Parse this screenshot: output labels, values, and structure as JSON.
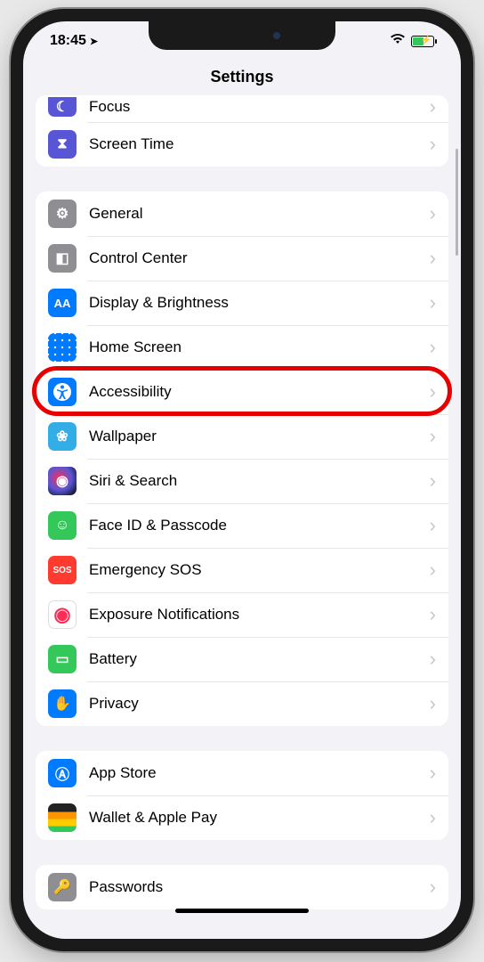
{
  "statusbar": {
    "time": "18:45",
    "location_arrow": "➤"
  },
  "navbar": {
    "title": "Settings"
  },
  "groups": [
    {
      "rows": [
        {
          "label": "Focus",
          "icon": "moon-icon",
          "bg": "bg-purple",
          "glyph": "☾",
          "truncated": true
        },
        {
          "label": "Screen Time",
          "icon": "hourglass-icon",
          "bg": "bg-purple",
          "glyph": "⧗"
        }
      ]
    },
    {
      "rows": [
        {
          "label": "General",
          "icon": "gear-icon",
          "bg": "bg-gray",
          "glyph": "⚙"
        },
        {
          "label": "Control Center",
          "icon": "switches-icon",
          "bg": "bg-gray",
          "glyph": "◧"
        },
        {
          "label": "Display & Brightness",
          "icon": "text-size-icon",
          "bg": "bg-blue",
          "glyph": "AA"
        },
        {
          "label": "Home Screen",
          "icon": "grid-icon",
          "bg": "bg-blue",
          "glyph": "",
          "grid": true
        },
        {
          "label": "Accessibility",
          "icon": "accessibility-icon",
          "bg": "bg-blue",
          "glyph": "⊕",
          "highlighted": true
        },
        {
          "label": "Wallpaper",
          "icon": "flower-icon",
          "bg": "bg-teal",
          "glyph": "❀"
        },
        {
          "label": "Siri & Search",
          "icon": "siri-icon",
          "bg": "bg-black",
          "glyph": "◉"
        },
        {
          "label": "Face ID & Passcode",
          "icon": "face-id-icon",
          "bg": "bg-green",
          "glyph": "☺"
        },
        {
          "label": "Emergency SOS",
          "icon": "sos-icon",
          "bg": "bg-red",
          "glyph": "SOS",
          "small": true
        },
        {
          "label": "Exposure Notifications",
          "icon": "exposure-icon",
          "bg": "bg-white",
          "glyph": "⬤",
          "pink": true
        },
        {
          "label": "Battery",
          "icon": "battery-icon",
          "bg": "bg-green",
          "glyph": "▭"
        },
        {
          "label": "Privacy",
          "icon": "hand-icon",
          "bg": "bg-blue",
          "glyph": "✋"
        }
      ]
    },
    {
      "rows": [
        {
          "label": "App Store",
          "icon": "app-store-icon",
          "bg": "bg-blue",
          "glyph": "Ⓐ"
        },
        {
          "label": "Wallet & Apple Pay",
          "icon": "wallet-icon",
          "bg": "bg-black",
          "glyph": "◱",
          "multicolor": true
        }
      ]
    },
    {
      "rows": [
        {
          "label": "Passwords",
          "icon": "key-icon",
          "bg": "bg-gray",
          "glyph": "🔑"
        }
      ]
    }
  ],
  "highlight": {
    "group": 1,
    "row": 4
  }
}
